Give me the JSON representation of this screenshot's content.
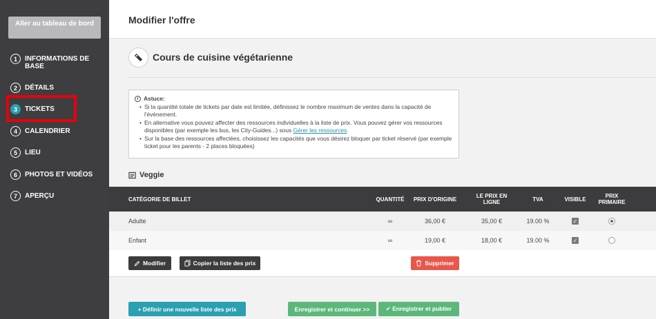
{
  "sidebar": {
    "dashboard_label": "Aller au tableau de bord",
    "items": [
      {
        "num": "1",
        "label": "INFORMATIONS DE BASE"
      },
      {
        "num": "2",
        "label": "DÉTAILS"
      },
      {
        "num": "3",
        "label": "TICKETS",
        "active": true
      },
      {
        "num": "4",
        "label": "CALENDRIER"
      },
      {
        "num": "5",
        "label": "LIEU"
      },
      {
        "num": "6",
        "label": "PHOTOS ET VIDÉOS"
      },
      {
        "num": "7",
        "label": "APERÇU"
      }
    ]
  },
  "header": {
    "title": "Modifier l'offre"
  },
  "offer": {
    "title": "Cours de cuisine végétarienne",
    "icon": "ticket-icon"
  },
  "tip": {
    "title": "Astuce:",
    "bullets": [
      "Si la quantité totale de tickets par date est limitée, définissez le nombre maximum de ventes dans la capacité de l'évènement.",
      "En alternative vous pouvez affecter des ressources individuelles à la liste de prix. Vous pouvez gérer vos ressources disponibles (par exemple les bus, les City-Guides...) sous",
      "Sur la base des ressources affectées, choisissez les capacités que vous désirez bloquer par ticket réservé (par exemple ticket pour les parents - 2 places bloquées)"
    ],
    "link": "Gérer les ressources",
    "link_suffix": "."
  },
  "pricelist": {
    "name": "Veggie",
    "columns": [
      "CATÉGORIE DE BILLET",
      "QUANTITÉ",
      "PRIX D'ORIGINE",
      "LE PRIX EN LIGNE",
      "TVA",
      "VISIBLE",
      "PRIX PRIMAIRE"
    ],
    "rows": [
      {
        "category": "Adulte",
        "quantity": "∞",
        "original": "36,00 €",
        "online": "35,00 €",
        "vat": "19.00 %",
        "visible": true,
        "primary": true
      },
      {
        "category": "Enfant",
        "quantity": "∞",
        "original": "19,00 €",
        "online": "18,00 €",
        "vat": "19.00 %",
        "visible": true,
        "primary": false
      }
    ],
    "modify_label": "Modifier",
    "copy_label": "Copier la liste des prix",
    "delete_label": "Supprimer"
  },
  "footer": {
    "new_list_label": "+ Définir une nouvelle liste des prix",
    "save_continue_label": "Enregistrer et continuer >>",
    "save_publish_label": "✔ Enregistrer et publier"
  },
  "colors": {
    "highlight": "#e8000b",
    "accent": "#2aa0b0",
    "danger": "#e8584a",
    "success": "#5cb87a",
    "sidebar": "#3e3e40"
  }
}
